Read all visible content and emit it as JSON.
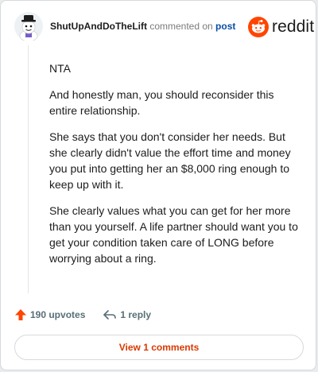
{
  "comment": {
    "username": "ShutUpAndDoTheLift",
    "action_text": "commented on",
    "post_link": "post",
    "brand": "reddit",
    "paragraphs": [
      "NTA",
      "And honestly man, you should reconsider this entire relationship.",
      "She says that you don't consider her needs. But she clearly didn't value the effort time and money you put into getting her an $8,000 ring enough to keep up with it.",
      "She clearly values what you can get for her more than you yourself. A life partner should want you to get your condition taken care of LONG before worrying about a ring."
    ],
    "upvotes": "190 upvotes",
    "replies": "1 reply",
    "view_comments": "View 1 comments"
  },
  "colors": {
    "brand_orange": "#ff4500",
    "link_blue": "#0a4fa3",
    "view_button_text": "#d93900"
  },
  "icons": {
    "avatar": "snoo-avatar-icon",
    "logo": "reddit-logo-icon",
    "upvote": "upvote-arrow-icon",
    "reply": "reply-arrow-icon"
  }
}
